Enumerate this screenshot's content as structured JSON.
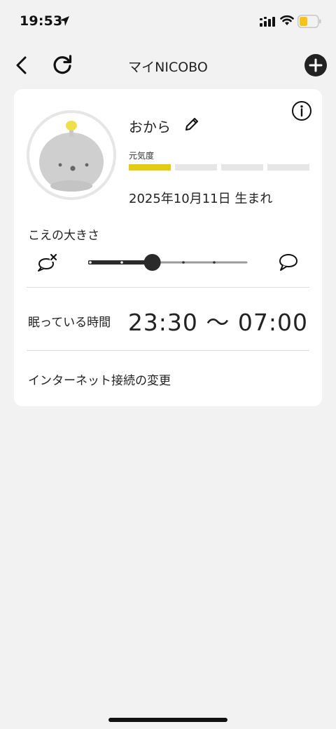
{
  "status_bar": {
    "time": "19:53",
    "icons": [
      "location-arrow-icon",
      "cellular-signal-icon",
      "wifi-icon",
      "battery-icon"
    ],
    "battery_fraction": 0.45,
    "battery_color": "#f3c41a"
  },
  "nav": {
    "title": "マイNICOBO",
    "back_icon": "chevron-left-icon",
    "refresh_icon": "refresh-icon",
    "add_icon": "plus-circle-icon"
  },
  "profile": {
    "name": "おから",
    "energy_label": "元気度",
    "energy_level": 1,
    "energy_segments": 4,
    "energy_color": "#e3cc12",
    "birth": "2025年10月11日 生まれ"
  },
  "volume": {
    "label": "こえの大きさ",
    "level": 0.4
  },
  "sleep": {
    "label": "眠っている時間",
    "time_range": "23:30 〜 07:00"
  },
  "network": {
    "label": "インターネット接続の変更"
  }
}
